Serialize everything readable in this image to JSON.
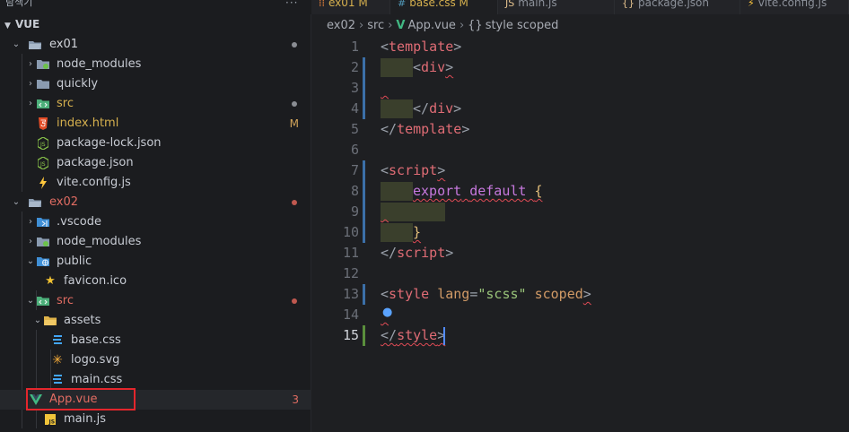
{
  "top": {
    "explorer_title": "탐색기",
    "more": "···",
    "tabs": [
      {
        "icon": "⁞⁞",
        "label": "ex01 M"
      },
      {
        "icon": "#",
        "label": "base.css M"
      },
      {
        "icon": "JS",
        "label": "main.js"
      },
      {
        "icon": "{}",
        "label": "package.json"
      },
      {
        "icon": "⚡",
        "label": "vite.config.js"
      }
    ]
  },
  "explorer": {
    "section": "VUE",
    "rows": [
      {
        "label": "ex01",
        "badge": "",
        "dot": "#8a8d93"
      },
      {
        "label": "node_modules",
        "badge": "",
        "dot": ""
      },
      {
        "label": "quickly",
        "badge": "",
        "dot": ""
      },
      {
        "label": "src",
        "badge": "",
        "dot": "#8a8d93"
      },
      {
        "label": "index.html",
        "badge": "M",
        "dot": ""
      },
      {
        "label": "package-lock.json",
        "badge": "",
        "dot": ""
      },
      {
        "label": "package.json",
        "badge": "",
        "dot": ""
      },
      {
        "label": "vite.config.js",
        "badge": "",
        "dot": ""
      },
      {
        "label": "ex02",
        "badge": "",
        "dot": "#c0584f"
      },
      {
        "label": ".vscode",
        "badge": "",
        "dot": ""
      },
      {
        "label": "node_modules",
        "badge": "",
        "dot": ""
      },
      {
        "label": "public",
        "badge": "",
        "dot": ""
      },
      {
        "label": "favicon.ico",
        "badge": "",
        "dot": ""
      },
      {
        "label": "src",
        "badge": "",
        "dot": "#c0584f"
      },
      {
        "label": "assets",
        "badge": "",
        "dot": ""
      },
      {
        "label": "base.css",
        "badge": "",
        "dot": ""
      },
      {
        "label": "logo.svg",
        "badge": "",
        "dot": ""
      },
      {
        "label": "main.css",
        "badge": "",
        "dot": ""
      },
      {
        "label": "App.vue",
        "badge": "3",
        "dot": ""
      },
      {
        "label": "main.js",
        "badge": "",
        "dot": ""
      }
    ]
  },
  "colors": {
    "modified_badge": "#d2a45a",
    "error_badge": "#e06c62",
    "vue_green": "#41b883",
    "highlight_red": "#e4262c"
  },
  "editor": {
    "breadcrumb": {
      "a": "ex02",
      "b": "src",
      "c": "App.vue",
      "d": "style scoped",
      "sep": "›",
      "vue_icon": "V",
      "braces": "{}"
    },
    "line_numbers": [
      "1",
      "2",
      "3",
      "4",
      "5",
      "6",
      "7",
      "8",
      "9",
      "10",
      "11",
      "12",
      "13",
      "14",
      "15"
    ],
    "code": {
      "l1": {
        "open": "<",
        "name": "template",
        "close": ">"
      },
      "l2": {
        "open": "<",
        "name": "div",
        "close": ">"
      },
      "l4": {
        "open": "</",
        "name": "div",
        "close": ">"
      },
      "l5": {
        "open": "</",
        "name": "template",
        "close": ">"
      },
      "l7": {
        "open": "<",
        "name": "script",
        "close": ">"
      },
      "l8": {
        "kw1": "export",
        "kw2": "default",
        "brace": "{"
      },
      "l10": {
        "brace": "}"
      },
      "l11": {
        "open": "</",
        "name": "script",
        "close": ">"
      },
      "l13": {
        "open": "<",
        "name": "style",
        "attr1": "lang",
        "eq": "=",
        "val": "\"scss\"",
        "attr2": "scoped",
        "close": ">"
      },
      "l15": {
        "open": "</",
        "name": "style",
        "close": ">"
      }
    }
  }
}
